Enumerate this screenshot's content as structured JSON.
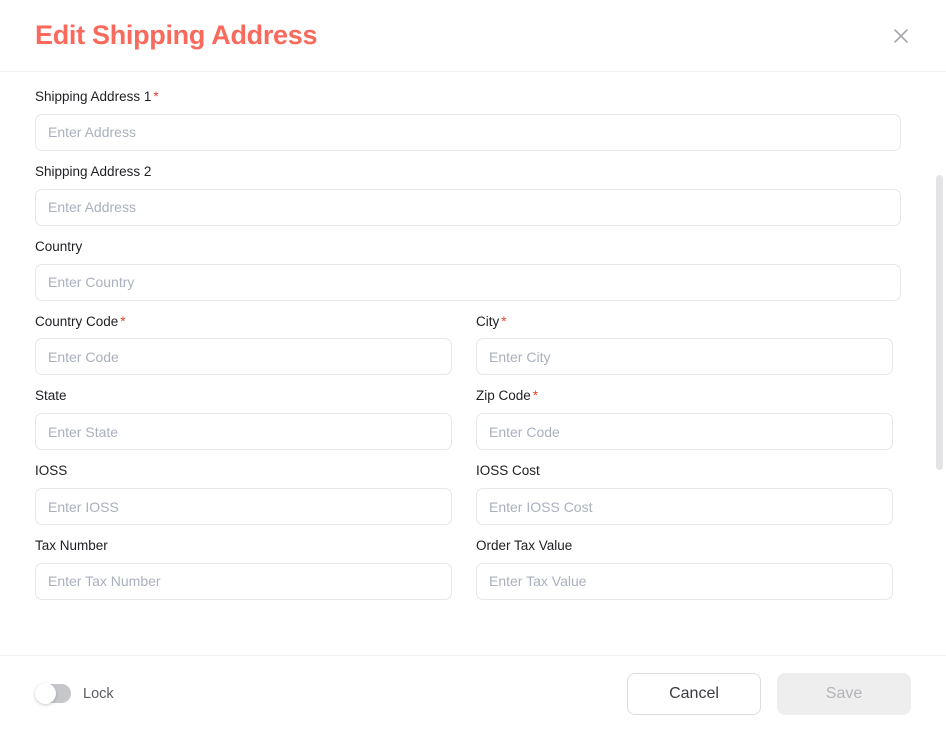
{
  "header": {
    "title": "Edit Shipping Address",
    "close_icon": "close-icon"
  },
  "form": {
    "rows": [
      {
        "type": "single",
        "fields": [
          {
            "label": "Shipping Address 1",
            "required": true,
            "placeholder": "Enter Address",
            "value": ""
          }
        ]
      },
      {
        "type": "single",
        "fields": [
          {
            "label": "Shipping Address 2",
            "required": false,
            "placeholder": "Enter Address",
            "value": ""
          }
        ]
      },
      {
        "type": "single",
        "fields": [
          {
            "label": "Country",
            "required": false,
            "placeholder": "Enter Country",
            "value": ""
          }
        ]
      },
      {
        "type": "double",
        "fields": [
          {
            "label": "Country Code",
            "required": true,
            "placeholder": "Enter Code",
            "value": ""
          },
          {
            "label": "City",
            "required": true,
            "placeholder": "Enter City",
            "value": ""
          }
        ]
      },
      {
        "type": "double",
        "fields": [
          {
            "label": "State",
            "required": false,
            "placeholder": "Enter State",
            "value": ""
          },
          {
            "label": "Zip Code",
            "required": true,
            "placeholder": "Enter Code",
            "value": ""
          }
        ]
      },
      {
        "type": "double",
        "fields": [
          {
            "label": "IOSS",
            "required": false,
            "placeholder": "Enter IOSS",
            "value": ""
          },
          {
            "label": "IOSS Cost",
            "required": false,
            "placeholder": "Enter IOSS Cost",
            "value": ""
          }
        ]
      },
      {
        "type": "double",
        "fields": [
          {
            "label": "Tax Number",
            "required": false,
            "placeholder": "Enter Tax Number",
            "value": ""
          },
          {
            "label": "Order Tax Value",
            "required": false,
            "placeholder": "Enter Tax Value",
            "value": ""
          }
        ]
      }
    ],
    "required_marker": "*"
  },
  "footer": {
    "lock_label": "Lock",
    "lock_enabled": false,
    "cancel_label": "Cancel",
    "save_label": "Save",
    "save_disabled": true
  },
  "colors": {
    "title": "#f9695c",
    "required": "#e8432c",
    "input_border": "#e6e7ea",
    "placeholder": "#aab0bd",
    "save_disabled_bg": "#eeeeef",
    "save_disabled_text": "#b4b4b8",
    "toggle_track": "#c6c7ca",
    "scrollbar_thumb": "#e4e4e6"
  }
}
